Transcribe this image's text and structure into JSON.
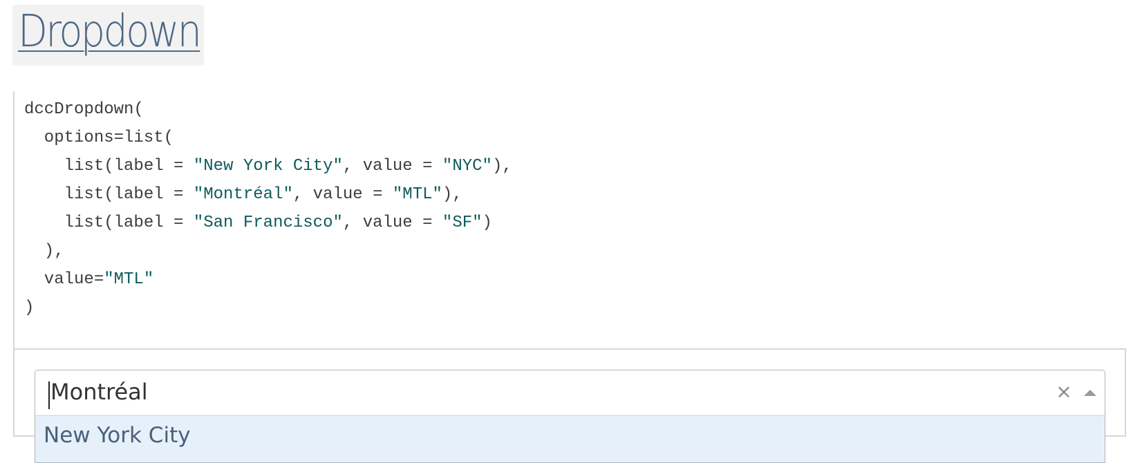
{
  "heading": {
    "title": "Dropdown"
  },
  "code": {
    "lines": [
      [
        {
          "t": "dccDropdown(",
          "s": false
        }
      ],
      [
        {
          "t": "  options=list(",
          "s": false
        }
      ],
      [
        {
          "t": "    list(label = ",
          "s": false
        },
        {
          "t": "\"New York City\"",
          "s": true
        },
        {
          "t": ", value = ",
          "s": false
        },
        {
          "t": "\"NYC\"",
          "s": true
        },
        {
          "t": "),",
          "s": false
        }
      ],
      [
        {
          "t": "    list(label = ",
          "s": false
        },
        {
          "t": "\"Montréal\"",
          "s": true
        },
        {
          "t": ", value = ",
          "s": false
        },
        {
          "t": "\"MTL\"",
          "s": true
        },
        {
          "t": "),",
          "s": false
        }
      ],
      [
        {
          "t": "    list(label = ",
          "s": false
        },
        {
          "t": "\"San Francisco\"",
          "s": true
        },
        {
          "t": ", value = ",
          "s": false
        },
        {
          "t": "\"SF\"",
          "s": true
        },
        {
          "t": ")",
          "s": false
        }
      ],
      [
        {
          "t": "  ),",
          "s": false
        }
      ],
      [
        {
          "t": "  value=",
          "s": false
        },
        {
          "t": "\"MTL\"",
          "s": true
        }
      ],
      [
        {
          "t": ")",
          "s": false
        }
      ]
    ]
  },
  "dropdown": {
    "selected_value": "Montréal",
    "clear_symbol": "×",
    "clear_icon": "close-icon",
    "arrow_icon": "caret-up-icon",
    "options": [
      {
        "label": "New York City",
        "highlighted": true
      }
    ]
  },
  "colors": {
    "heading_link": "#506784",
    "string_literal": "#0e5a5a",
    "option_highlight": "#e6f0fb"
  }
}
